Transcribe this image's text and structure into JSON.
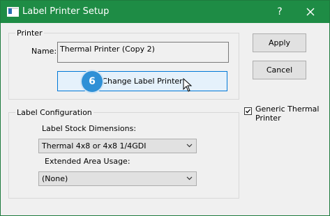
{
  "window": {
    "title": "Label Printer Setup",
    "help_glyph": "?",
    "colors": {
      "titlebar": "#1e8c45",
      "accent": "#0078d7",
      "badge": "#2f90d6"
    }
  },
  "printer_group": {
    "label": "Printer",
    "name_label": "Name:",
    "name_value": "Thermal Printer (Copy 2)",
    "change_button": "Change Label Printer",
    "step_badge": "6"
  },
  "actions": {
    "apply": "Apply",
    "cancel": "Cancel"
  },
  "generic_thermal": {
    "label": "Generic Thermal Printer",
    "checked": true
  },
  "label_config": {
    "label": "Label Configuration",
    "stock_label": "Label Stock Dimensions:",
    "stock_value": "Thermal 4x8 or 4x8 1/4GDI",
    "extended_label": "Extended Area Usage:",
    "extended_value": "(None)"
  }
}
